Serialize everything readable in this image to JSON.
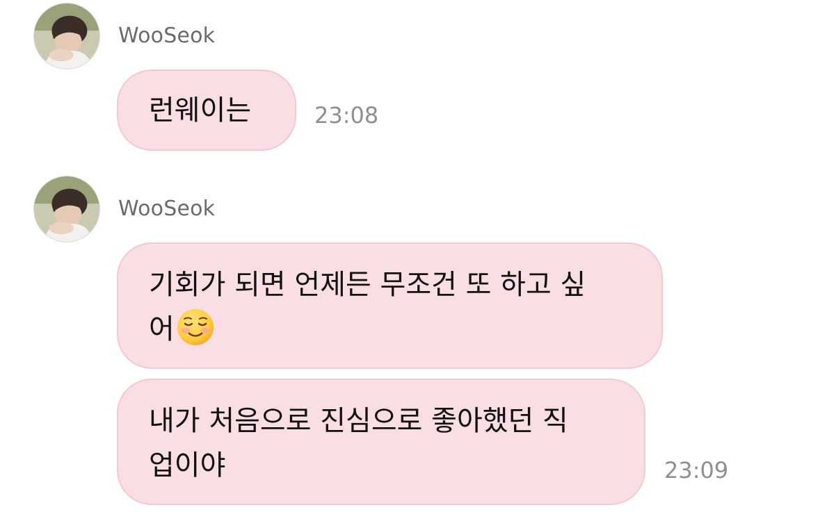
{
  "messages": [
    {
      "sender": "WooSeok",
      "text": "런웨이는",
      "time": "23:08"
    },
    {
      "sender": "WooSeok",
      "text_line1": "기회가 되면 언제든 무조건 또 하고 싶",
      "text_line2": "어",
      "emoji": "smiling-face-emoji"
    },
    {
      "text_line1": "내가 처음으로 진심으로 좋아했던 직",
      "text_line2": "업이야",
      "time": "23:09"
    }
  ],
  "colors": {
    "bubble_bg": "#f9dfe4",
    "bubble_border": "#f3c9d1",
    "sender_name": "#6b6b6b",
    "timestamp": "#8f8f8f",
    "message_text": "#111111"
  }
}
